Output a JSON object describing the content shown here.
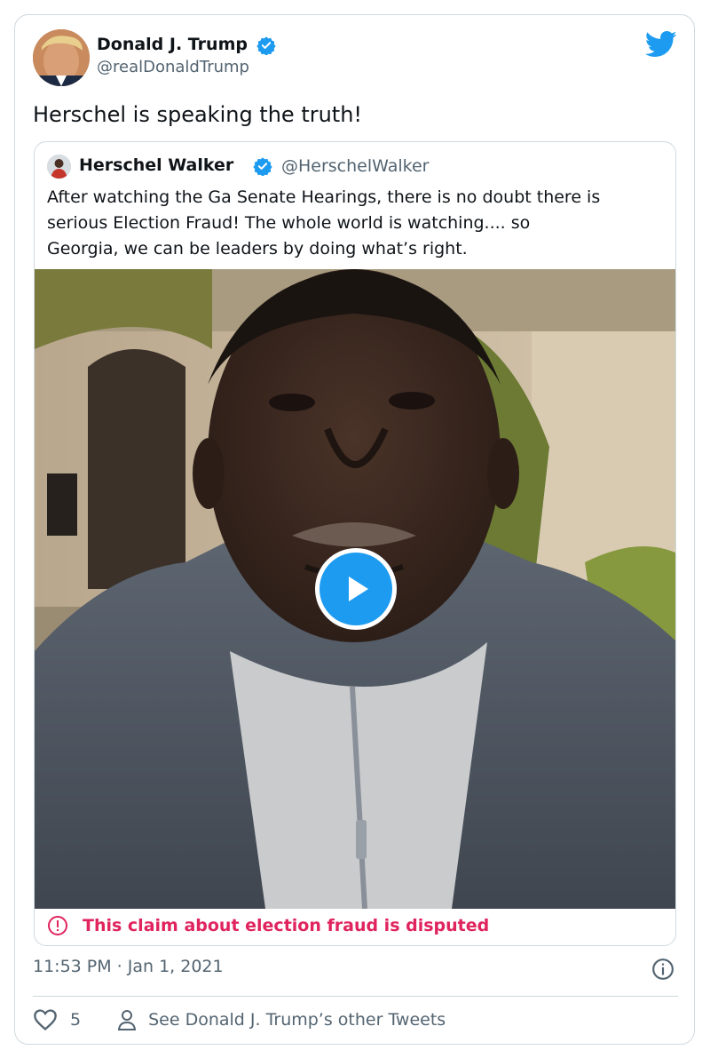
{
  "tweet": {
    "author": {
      "name": "Donald J. Trump",
      "handle": "@realDonaldTrump",
      "verified": true
    },
    "text": "Herschel is speaking the truth!",
    "quoted_tweet": {
      "author": {
        "name": "Herschel Walker",
        "handle": "@HerschelWalker",
        "verified": true
      },
      "text_lines": [
        "After watching the Ga Senate Hearings, there is no doubt there is",
        "serious Election Fraud! The whole world is watching.... so",
        "Georgia, we can be leaders by doing what’s right."
      ],
      "media": {
        "type": "video",
        "play_icon": "play-icon"
      },
      "disputed_label": "This claim about election fraud is disputed"
    },
    "timestamp": "11:53 PM · Jan 1, 2021",
    "likes": "5",
    "other_tweets_link": "See Donald J. Trump’s other Tweets"
  },
  "colors": {
    "twitter_blue": "#1d9bf0",
    "text_primary": "#0f1419",
    "text_secondary": "#536471",
    "border": "#cfd9de",
    "disputed_red": "#e0245e"
  },
  "icons": {
    "logo": "twitter-bird-icon",
    "verified": "verified-badge-icon",
    "alert": "alert-circle-icon",
    "info": "info-icon",
    "like": "heart-icon",
    "profile": "person-icon"
  }
}
